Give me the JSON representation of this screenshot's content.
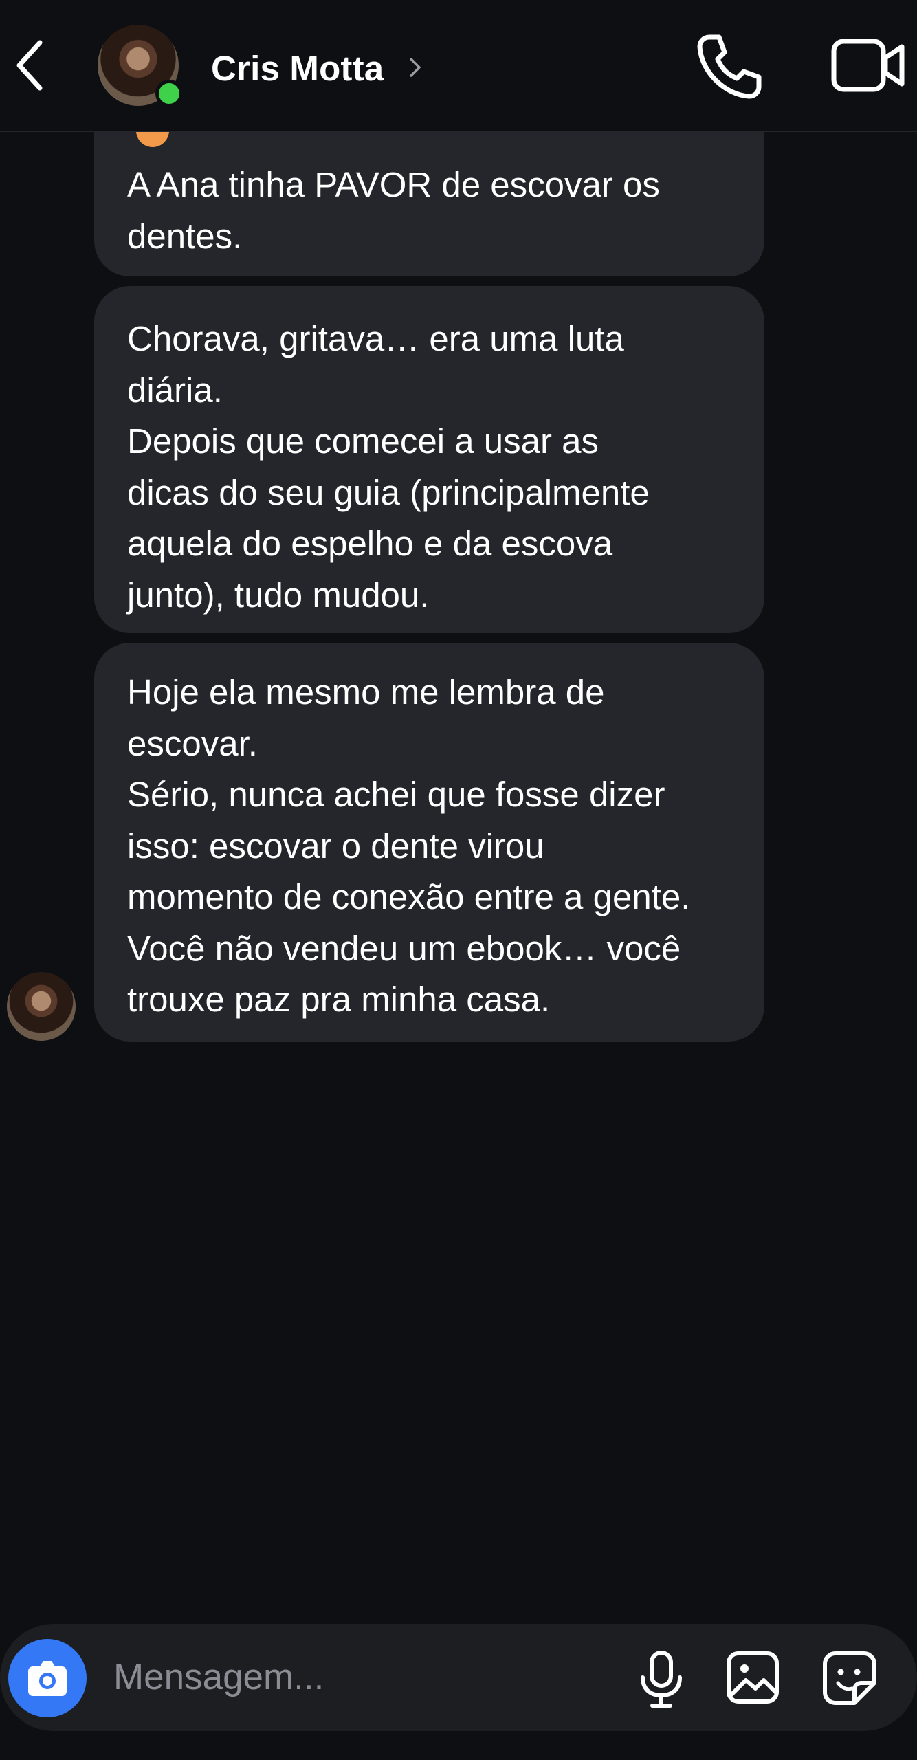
{
  "header": {
    "contact_name": "Cris Motta",
    "online_status_color": "#3fd14a",
    "icons": [
      "back-arrow-icon",
      "chevron-right-icon",
      "phone-icon",
      "video-camera-icon"
    ]
  },
  "messages": [
    {
      "lines": [
        "A Ana tinha PAVOR de escovar os",
        "dentes."
      ]
    },
    {
      "lines": [
        "Chorava, gritava… era uma luta",
        "diária.",
        "Depois que comecei a usar as",
        "dicas do seu guia (principalmente",
        "aquela do espelho e da escova",
        "junto), tudo mudou."
      ]
    },
    {
      "lines": [
        "Hoje ela mesmo me lembra de",
        "escovar.",
        "Sério, nunca achei que fosse dizer",
        "isso: escovar o dente virou",
        "momento de conexão entre a gente.",
        "Você não vendeu um ebook… você",
        "trouxe paz pra minha casa."
      ]
    }
  ],
  "composer": {
    "placeholder": "Mensagem...",
    "camera_color": "#3478f6",
    "icons": [
      "camera-icon",
      "microphone-icon",
      "gallery-icon",
      "sticker-icon"
    ]
  },
  "colors": {
    "background": "#0e0f13",
    "bubble": "#24262b",
    "composer": "#1d1e22"
  }
}
